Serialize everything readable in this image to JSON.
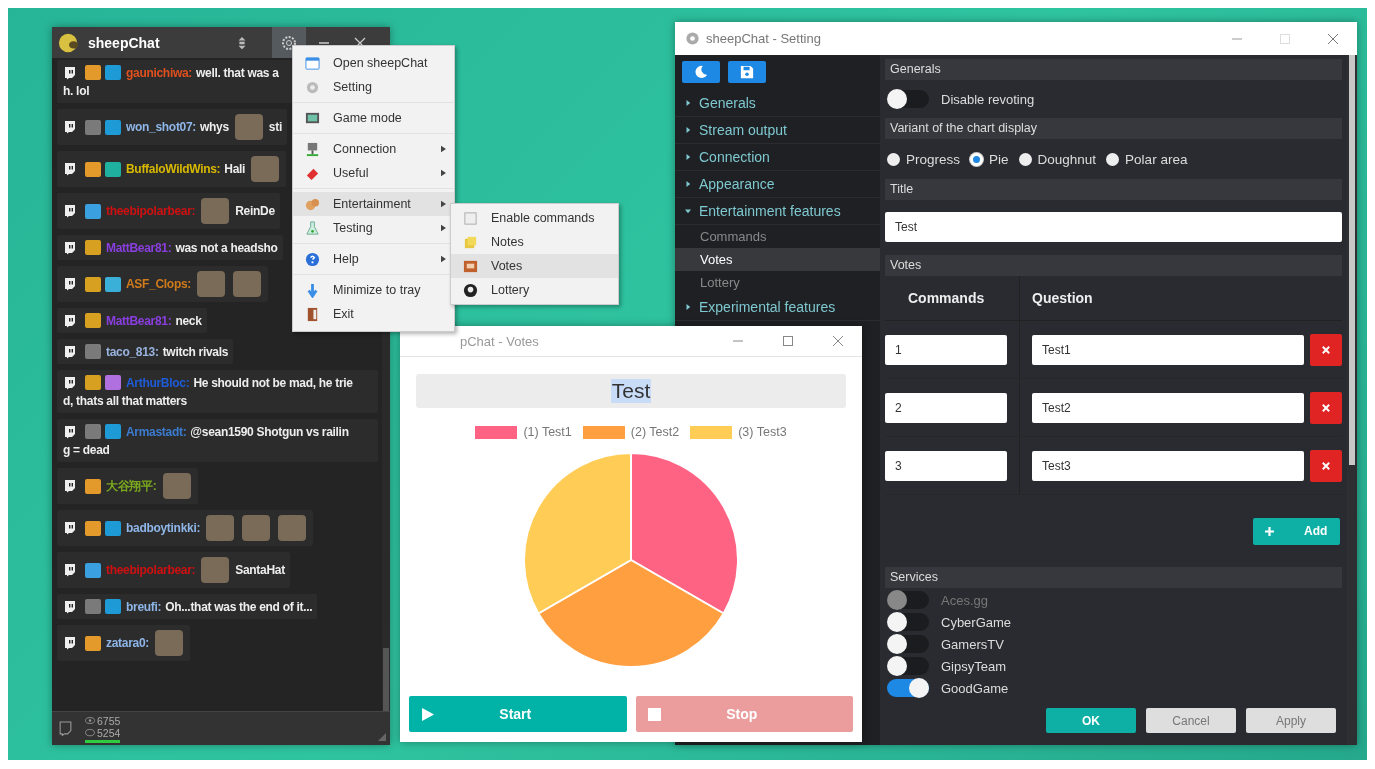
{
  "chat": {
    "title": "sheepChat",
    "messages": [
      {
        "user": "gaunichiwa:",
        "color": "#e0501e",
        "badges": [
          {
            "color": "#e39a2a"
          },
          {
            "color": "#1e9ad6"
          }
        ],
        "parts": [
          {
            "kind": "text",
            "text": "well. that was a"
          },
          {
            "kind": "break"
          },
          {
            "kind": "text",
            "text": "h. lol"
          }
        ]
      },
      {
        "user": "won_shot07:",
        "color": "#8fb6e8",
        "badges": [
          {
            "color": "#7a7a7a"
          },
          {
            "color": "#1e9ad6"
          }
        ],
        "parts": [
          {
            "kind": "text",
            "text": "whys"
          },
          {
            "kind": "emote"
          },
          {
            "kind": "text",
            "text": "sti"
          }
        ]
      },
      {
        "user": "BuffaloWildWins:",
        "color": "#d8b800",
        "badges": [
          {
            "color": "#e39a2a"
          },
          {
            "color": "#20b0a0"
          }
        ],
        "parts": [
          {
            "kind": "text",
            "text": "Hali"
          },
          {
            "kind": "emote"
          }
        ]
      },
      {
        "user": "theebipolarbear:",
        "color": "#d01010",
        "badges": [
          {
            "color": "#3aa0e0"
          }
        ],
        "parts": [
          {
            "kind": "emote"
          },
          {
            "kind": "text",
            "text": "ReinDe"
          }
        ]
      },
      {
        "user": "MattBear81:",
        "color": "#8a3ee0",
        "badges": [
          {
            "color": "#d8a020"
          }
        ],
        "parts": [
          {
            "kind": "text",
            "text": "was not a headsho"
          }
        ]
      },
      {
        "user": "ASF_Clops:",
        "color": "#d07a1a",
        "badges": [
          {
            "color": "#d8a020"
          },
          {
            "color": "#3ab0d8"
          }
        ],
        "parts": [
          {
            "kind": "emote"
          },
          {
            "kind": "emote"
          }
        ]
      },
      {
        "user": "MattBear81:",
        "color": "#8a3ee0",
        "badges": [
          {
            "color": "#d8a020"
          }
        ],
        "parts": [
          {
            "kind": "text",
            "text": "neck"
          }
        ]
      },
      {
        "user": "taco_813:",
        "color": "#9ab4e0",
        "badges": [
          {
            "color": "#7a7a7a"
          }
        ],
        "parts": [
          {
            "kind": "text",
            "text": "twitch rivals"
          }
        ]
      },
      {
        "user": "ArthurBloc:",
        "color": "#1e5bd8",
        "badges": [
          {
            "color": "#d8a020"
          },
          {
            "color": "#b070e0"
          }
        ],
        "parts": [
          {
            "kind": "text",
            "text": "He should not be mad, he trie"
          },
          {
            "kind": "break"
          },
          {
            "kind": "text",
            "text": "d, thats all that matters"
          }
        ]
      },
      {
        "user": "Armastadt:",
        "color": "#3b7bd0",
        "badges": [
          {
            "color": "#7a7a7a"
          },
          {
            "color": "#1e9ad6"
          }
        ],
        "parts": [
          {
            "kind": "text",
            "text": "@sean1590 Shotgun vs railin"
          },
          {
            "kind": "break"
          },
          {
            "kind": "text",
            "text": "g = dead"
          }
        ]
      },
      {
        "user": "大谷翔平:",
        "color": "#7aa81e",
        "badges": [
          {
            "color": "#e39a2a"
          }
        ],
        "parts": [
          {
            "kind": "emote"
          }
        ]
      },
      {
        "user": "badboytinkki:",
        "color": "#8fb6e8",
        "badges": [
          {
            "color": "#e39a2a"
          },
          {
            "color": "#1e9ad6"
          }
        ],
        "parts": [
          {
            "kind": "emote"
          },
          {
            "kind": "emote"
          },
          {
            "kind": "emote"
          }
        ]
      },
      {
        "user": "theebipolarbear:",
        "color": "#d01010",
        "badges": [
          {
            "color": "#3aa0e0"
          }
        ],
        "parts": [
          {
            "kind": "emote"
          },
          {
            "kind": "text",
            "text": "SantaHat"
          }
        ]
      },
      {
        "user": "breufi:",
        "color": "#8fb6e8",
        "badges": [
          {
            "color": "#7a7a7a"
          },
          {
            "color": "#1e9ad6"
          }
        ],
        "parts": [
          {
            "kind": "text",
            "text": "Oh...that was the end of it..."
          }
        ]
      },
      {
        "user": "zatara0:",
        "color": "#8fb6e8",
        "badges": [
          {
            "color": "#e39a2a"
          }
        ],
        "parts": [
          {
            "kind": "emote"
          }
        ]
      }
    ],
    "viewers": "6755",
    "chatters": "5254"
  },
  "menu": {
    "groups": [
      [
        {
          "label": "Open sheepChat",
          "submenu": false,
          "selected": false
        },
        {
          "label": "Setting",
          "submenu": false,
          "selected": false
        }
      ],
      [
        {
          "label": "Game mode",
          "submenu": false,
          "selected": false
        }
      ],
      [
        {
          "label": "Connection",
          "submenu": true,
          "selected": false
        },
        {
          "label": "Useful",
          "submenu": true,
          "selected": false
        }
      ],
      [
        {
          "label": "Entertainment",
          "submenu": true,
          "selected": true
        },
        {
          "label": "Testing",
          "submenu": true,
          "selected": false
        }
      ],
      [
        {
          "label": "Help",
          "submenu": true,
          "selected": false
        }
      ],
      [
        {
          "label": "Minimize to tray",
          "submenu": false,
          "selected": false
        },
        {
          "label": "Exit",
          "submenu": false,
          "selected": false
        }
      ]
    ],
    "submenu": [
      {
        "label": "Enable commands",
        "selected": false
      },
      {
        "label": "Notes",
        "selected": false
      },
      {
        "label": "Votes",
        "selected": true
      },
      {
        "label": "Lottery",
        "selected": false
      }
    ]
  },
  "votes_window": {
    "title": "pChat - Votes",
    "heading": "Test",
    "legend": [
      {
        "label": "(1) Test1",
        "color": "#ff6384"
      },
      {
        "label": "(2) Test2",
        "color": "#ff9f40"
      },
      {
        "label": "(3) Test3",
        "color": "#ffcd56"
      }
    ],
    "buttons": [
      {
        "label": "Start",
        "kind": "start"
      },
      {
        "label": "Stop",
        "kind": "stop"
      }
    ]
  },
  "settings_window": {
    "title": "sheepChat - Setting",
    "nav": [
      {
        "label": "Generals",
        "expanded": false
      },
      {
        "label": "Stream output",
        "expanded": false
      },
      {
        "label": "Connection",
        "expanded": false
      },
      {
        "label": "Appearance",
        "expanded": false
      },
      {
        "label": "Entertainment features",
        "expanded": true,
        "children": [
          {
            "label": "Commands",
            "selected": false
          },
          {
            "label": "Votes",
            "selected": true
          },
          {
            "label": "Lottery",
            "selected": false
          }
        ]
      },
      {
        "label": "Experimental features",
        "expanded": false
      }
    ],
    "generals": {
      "header": "Generals",
      "toggle": {
        "label": "Disable revoting",
        "on": false
      }
    },
    "chart_variant": {
      "header": "Variant of the chart display",
      "options": [
        {
          "label": "Progress",
          "selected": false
        },
        {
          "label": "Pie",
          "selected": true
        },
        {
          "label": "Doughnut",
          "selected": false
        },
        {
          "label": "Polar area",
          "selected": false
        }
      ]
    },
    "title_field": {
      "header": "Title",
      "value": "Test"
    },
    "votes": {
      "header": "Votes",
      "columns": [
        "Commands",
        "Question"
      ],
      "rows": [
        {
          "command": "1",
          "question": "Test1"
        },
        {
          "command": "2",
          "question": "Test2"
        },
        {
          "command": "3",
          "question": "Test3"
        }
      ],
      "add_label": "Add"
    },
    "services": {
      "header": "Services",
      "items": [
        {
          "label": "Aces.gg",
          "on": false,
          "disabled": true
        },
        {
          "label": "CyberGame",
          "on": false,
          "disabled": false
        },
        {
          "label": "GamersTV",
          "on": false,
          "disabled": false
        },
        {
          "label": "GipsyTeam",
          "on": false,
          "disabled": false
        },
        {
          "label": "GoodGame",
          "on": true,
          "disabled": false
        }
      ]
    },
    "buttons": [
      {
        "label": "OK",
        "kind": "primary"
      },
      {
        "label": "Cancel",
        "kind": "secondary"
      },
      {
        "label": "Apply",
        "kind": "secondary"
      }
    ]
  }
}
